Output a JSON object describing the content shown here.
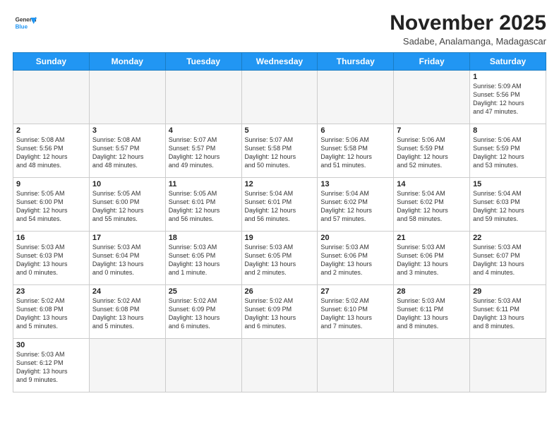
{
  "header": {
    "logo": {
      "general": "General",
      "blue": "Blue"
    },
    "title": "November 2025",
    "location": "Sadabe, Analamanga, Madagascar"
  },
  "weekdays": [
    "Sunday",
    "Monday",
    "Tuesday",
    "Wednesday",
    "Thursday",
    "Friday",
    "Saturday"
  ],
  "weeks": [
    [
      {
        "date": "",
        "info": ""
      },
      {
        "date": "",
        "info": ""
      },
      {
        "date": "",
        "info": ""
      },
      {
        "date": "",
        "info": ""
      },
      {
        "date": "",
        "info": ""
      },
      {
        "date": "",
        "info": ""
      },
      {
        "date": "1",
        "info": "Sunrise: 5:09 AM\nSunset: 5:56 PM\nDaylight: 12 hours\nand 47 minutes."
      }
    ],
    [
      {
        "date": "2",
        "info": "Sunrise: 5:08 AM\nSunset: 5:56 PM\nDaylight: 12 hours\nand 48 minutes."
      },
      {
        "date": "3",
        "info": "Sunrise: 5:08 AM\nSunset: 5:57 PM\nDaylight: 12 hours\nand 48 minutes."
      },
      {
        "date": "4",
        "info": "Sunrise: 5:07 AM\nSunset: 5:57 PM\nDaylight: 12 hours\nand 49 minutes."
      },
      {
        "date": "5",
        "info": "Sunrise: 5:07 AM\nSunset: 5:58 PM\nDaylight: 12 hours\nand 50 minutes."
      },
      {
        "date": "6",
        "info": "Sunrise: 5:06 AM\nSunset: 5:58 PM\nDaylight: 12 hours\nand 51 minutes."
      },
      {
        "date": "7",
        "info": "Sunrise: 5:06 AM\nSunset: 5:59 PM\nDaylight: 12 hours\nand 52 minutes."
      },
      {
        "date": "8",
        "info": "Sunrise: 5:06 AM\nSunset: 5:59 PM\nDaylight: 12 hours\nand 53 minutes."
      }
    ],
    [
      {
        "date": "9",
        "info": "Sunrise: 5:05 AM\nSunset: 6:00 PM\nDaylight: 12 hours\nand 54 minutes."
      },
      {
        "date": "10",
        "info": "Sunrise: 5:05 AM\nSunset: 6:00 PM\nDaylight: 12 hours\nand 55 minutes."
      },
      {
        "date": "11",
        "info": "Sunrise: 5:05 AM\nSunset: 6:01 PM\nDaylight: 12 hours\nand 56 minutes."
      },
      {
        "date": "12",
        "info": "Sunrise: 5:04 AM\nSunset: 6:01 PM\nDaylight: 12 hours\nand 56 minutes."
      },
      {
        "date": "13",
        "info": "Sunrise: 5:04 AM\nSunset: 6:02 PM\nDaylight: 12 hours\nand 57 minutes."
      },
      {
        "date": "14",
        "info": "Sunrise: 5:04 AM\nSunset: 6:02 PM\nDaylight: 12 hours\nand 58 minutes."
      },
      {
        "date": "15",
        "info": "Sunrise: 5:04 AM\nSunset: 6:03 PM\nDaylight: 12 hours\nand 59 minutes."
      }
    ],
    [
      {
        "date": "16",
        "info": "Sunrise: 5:03 AM\nSunset: 6:03 PM\nDaylight: 13 hours\nand 0 minutes."
      },
      {
        "date": "17",
        "info": "Sunrise: 5:03 AM\nSunset: 6:04 PM\nDaylight: 13 hours\nand 0 minutes."
      },
      {
        "date": "18",
        "info": "Sunrise: 5:03 AM\nSunset: 6:05 PM\nDaylight: 13 hours\nand 1 minute."
      },
      {
        "date": "19",
        "info": "Sunrise: 5:03 AM\nSunset: 6:05 PM\nDaylight: 13 hours\nand 2 minutes."
      },
      {
        "date": "20",
        "info": "Sunrise: 5:03 AM\nSunset: 6:06 PM\nDaylight: 13 hours\nand 2 minutes."
      },
      {
        "date": "21",
        "info": "Sunrise: 5:03 AM\nSunset: 6:06 PM\nDaylight: 13 hours\nand 3 minutes."
      },
      {
        "date": "22",
        "info": "Sunrise: 5:03 AM\nSunset: 6:07 PM\nDaylight: 13 hours\nand 4 minutes."
      }
    ],
    [
      {
        "date": "23",
        "info": "Sunrise: 5:02 AM\nSunset: 6:08 PM\nDaylight: 13 hours\nand 5 minutes."
      },
      {
        "date": "24",
        "info": "Sunrise: 5:02 AM\nSunset: 6:08 PM\nDaylight: 13 hours\nand 5 minutes."
      },
      {
        "date": "25",
        "info": "Sunrise: 5:02 AM\nSunset: 6:09 PM\nDaylight: 13 hours\nand 6 minutes."
      },
      {
        "date": "26",
        "info": "Sunrise: 5:02 AM\nSunset: 6:09 PM\nDaylight: 13 hours\nand 6 minutes."
      },
      {
        "date": "27",
        "info": "Sunrise: 5:02 AM\nSunset: 6:10 PM\nDaylight: 13 hours\nand 7 minutes."
      },
      {
        "date": "28",
        "info": "Sunrise: 5:03 AM\nSunset: 6:11 PM\nDaylight: 13 hours\nand 8 minutes."
      },
      {
        "date": "29",
        "info": "Sunrise: 5:03 AM\nSunset: 6:11 PM\nDaylight: 13 hours\nand 8 minutes."
      }
    ],
    [
      {
        "date": "30",
        "info": "Sunrise: 5:03 AM\nSunset: 6:12 PM\nDaylight: 13 hours\nand 9 minutes."
      },
      {
        "date": "",
        "info": ""
      },
      {
        "date": "",
        "info": ""
      },
      {
        "date": "",
        "info": ""
      },
      {
        "date": "",
        "info": ""
      },
      {
        "date": "",
        "info": ""
      },
      {
        "date": "",
        "info": ""
      }
    ]
  ]
}
